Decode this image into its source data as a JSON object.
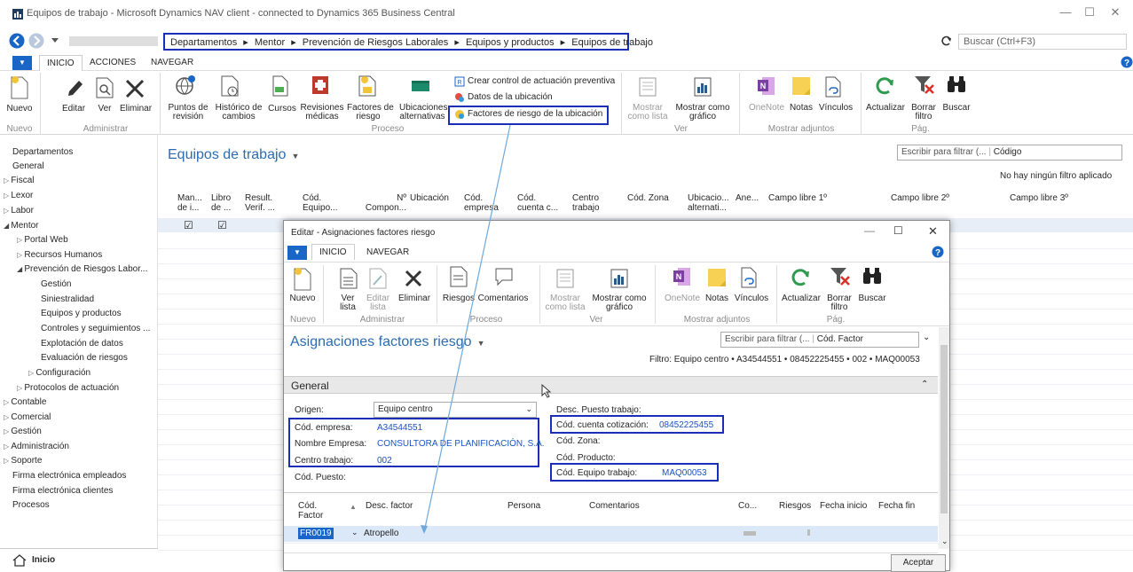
{
  "window": {
    "title": "Equipos de trabajo - Microsoft Dynamics NAV client - connected to Dynamics 365 Business Central",
    "minimize": "—",
    "maximize": "☐",
    "close": "✕"
  },
  "address": {
    "crumbs": [
      "Departamentos",
      "Mentor",
      "Prevención de Riesgos Laborales",
      "Equipos y productos",
      "Equipos de trabajo"
    ],
    "separator": "▸",
    "search_placeholder": "Buscar (Ctrl+F3)"
  },
  "ribbon": {
    "tabs": [
      "INICIO",
      "ACCIONES",
      "NAVEGAR"
    ],
    "buttons": {
      "nuevo": "Nuevo",
      "editar": "Editar",
      "ver": "Ver",
      "eliminar": "Eliminar",
      "puntos": "Puntos de\nrevisión",
      "historico": "Histórico de\ncambios",
      "cursos": "Cursos",
      "revisiones": "Revisiones\nmédicas",
      "factores": "Factores de\nriesgo",
      "ubicaciones": "Ubicaciones\nalternativas",
      "mostrar_lista": "Mostrar\ncomo lista",
      "mostrar_grafico": "Mostrar como\ngráfico",
      "onenote": "OneNote",
      "notas": "Notas",
      "vinculos": "Vínculos",
      "actualizar": "Actualizar",
      "borrar_filtro": "Borrar\nfiltro",
      "buscar": "Buscar"
    },
    "small": {
      "crear_control": "Crear control de actuación preventiva",
      "datos_ubicacion": "Datos de la ubicación",
      "factores_ubicacion": "Factores de riesgo de la ubicación"
    },
    "groups": {
      "nuevo": "Nuevo",
      "administrar": "Administrar",
      "proceso": "Proceso",
      "ver": "Ver",
      "adjuntos": "Mostrar adjuntos",
      "pag": "Pág."
    }
  },
  "nav": {
    "items": [
      "Departamentos",
      "General",
      "Fiscal",
      "Lexor",
      "Labor",
      "Mentor",
      "Portal Web",
      "Recursos Humanos",
      "Prevención de Riesgos Labor...",
      "Gestión",
      "Siniestralidad",
      "Equipos y productos",
      "Controles y seguimientos ...",
      "Explotación de datos",
      "Evaluación de riesgos",
      "Configuración",
      "Protocolos de actuación",
      "Contable",
      "Comercial",
      "Gestión",
      "Administración",
      "Soporte",
      "Firma electrónica empleados",
      "Firma electrónica clientes",
      "Procesos"
    ],
    "home": "Inicio"
  },
  "main": {
    "title": "Equipos de trabajo",
    "filter_placeholder": "Escribir para filtrar (...",
    "filter_field": "Código",
    "no_filter": "No hay ningún filtro aplicado",
    "columns": [
      "Man...\nde i...",
      "Libro\nde ...",
      "Result.\nVerif. ...",
      "Cód.\nEquipo...",
      "Nº\nCompon...",
      "Ubicación",
      "Cód.\nempresa",
      "Cód.\ncuenta c...",
      "Centro\ntrabajo",
      "Cód. Zona",
      "Ubicacio...\nalternati...",
      "Ane...",
      "Campo libre 1º",
      "Campo libre 2º",
      "Campo libre 3º"
    ],
    "check1": "☑",
    "check2": "☑"
  },
  "dialog": {
    "title": "Editar - Asignaciones factores riesgo",
    "tabs": [
      "INICIO",
      "NAVEGAR"
    ],
    "buttons": {
      "nuevo": "Nuevo",
      "ver_lista": "Ver\nlista",
      "editar_lista": "Editar\nlista",
      "eliminar": "Eliminar",
      "riesgos": "Riesgos",
      "comentarios": "Comentarios",
      "mostrar_lista": "Mostrar\ncomo lista",
      "mostrar_grafico": "Mostrar como\ngráfico",
      "onenote": "OneNote",
      "notas": "Notas",
      "vinculos": "Vínculos",
      "actualizar": "Actualizar",
      "borrar_filtro": "Borrar\nfiltro",
      "buscar": "Buscar"
    },
    "groups": {
      "nuevo": "Nuevo",
      "administrar": "Administrar",
      "proceso": "Proceso",
      "ver": "Ver",
      "adjuntos": "Mostrar adjuntos",
      "pag": "Pág."
    },
    "page_title": "Asignaciones factores riesgo",
    "filter_placeholder": "Escribir para filtrar (...",
    "filter_field": "Cód. Factor",
    "filter_text": "Filtro: Equipo centro • A34544551 • 08452225455 • 002 • MAQ00053",
    "section": "General",
    "fields": {
      "origen_label": "Origen:",
      "origen_value": "Equipo centro",
      "empresa_label": "Cód. empresa:",
      "empresa_value": "A34544551",
      "nombre_label": "Nombre Empresa:",
      "nombre_value": "CONSULTORA DE PLANIFICACIÓN, S.A.",
      "centro_label": "Centro trabajo:",
      "centro_value": "002",
      "puesto_label": "Cód. Puesto:",
      "desc_puesto_label": "Desc. Puesto trabajo:",
      "cuenta_label": "Cód. cuenta cotización:",
      "cuenta_value": "08452225455",
      "zona_label": "Cód. Zona:",
      "producto_label": "Cód. Producto:",
      "equipo_label": "Cód. Equipo trabajo:",
      "equipo_value": "MAQ00053"
    },
    "columns": [
      "Cód.\nFactor",
      "Desc. factor",
      "Persona",
      "Comentarios",
      "Co...",
      "Riesgos",
      "Fecha inicio",
      "Fecha fin"
    ],
    "row": {
      "codigo": "FR0019",
      "desc": "Atropello"
    },
    "accept": "Aceptar"
  }
}
